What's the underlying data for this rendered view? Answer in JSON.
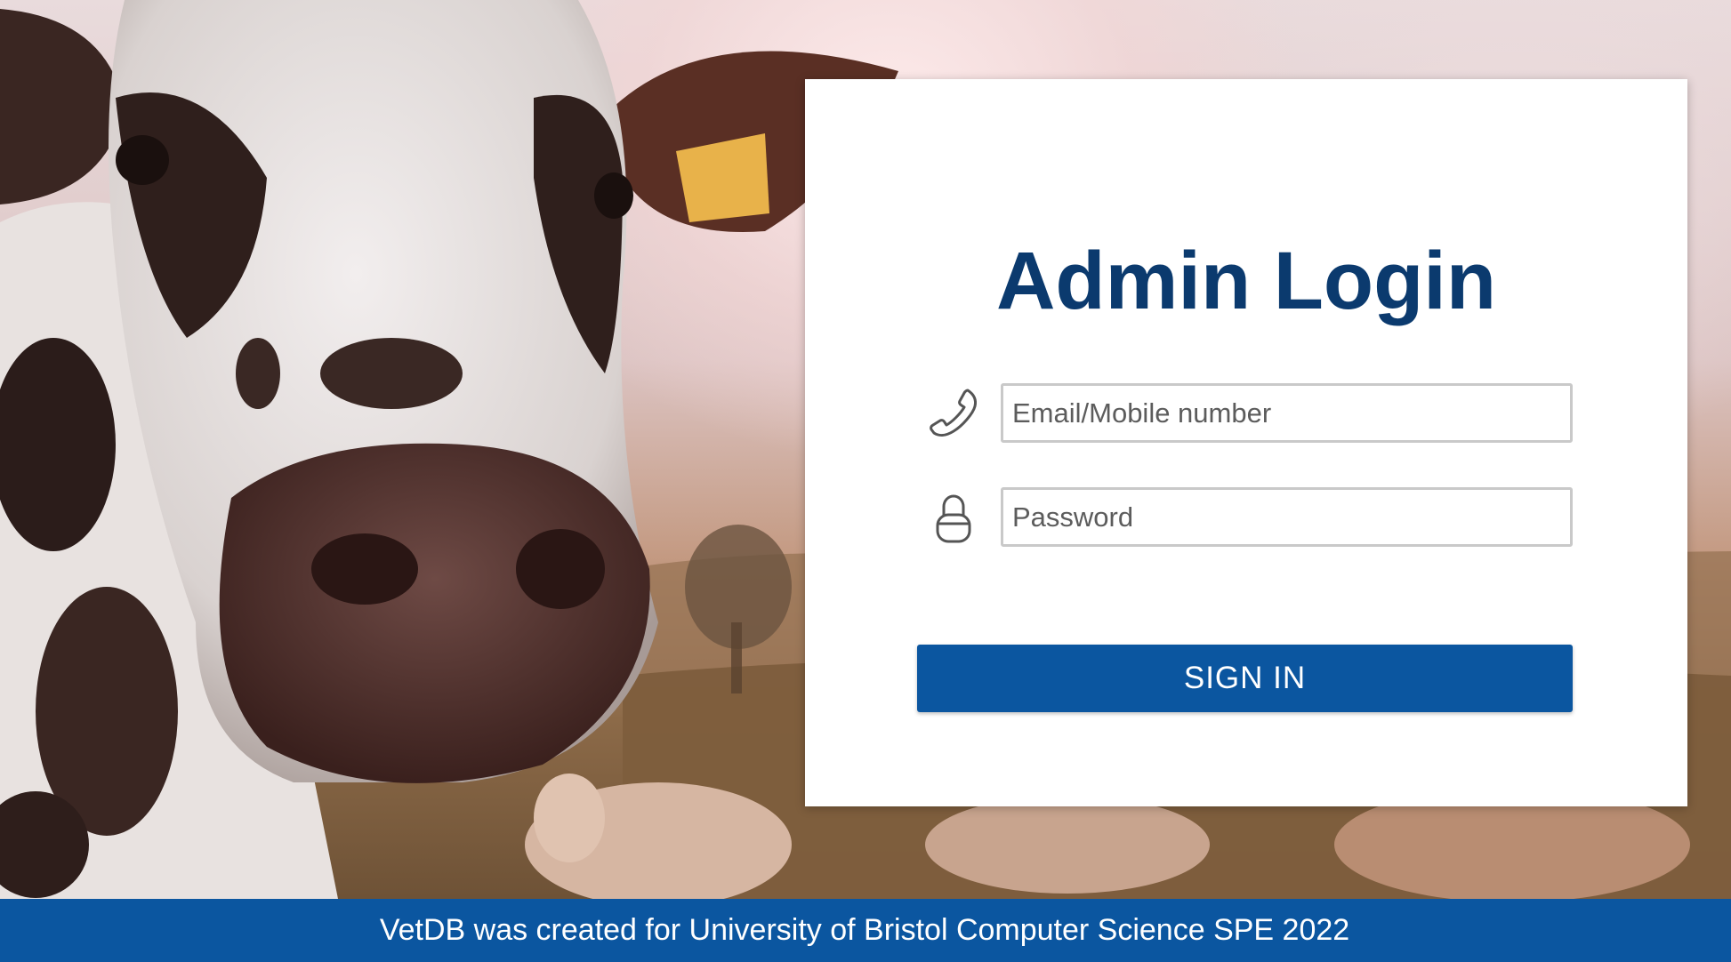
{
  "login_card": {
    "title": "Admin Login",
    "email_placeholder": "Email/Mobile number",
    "password_placeholder": "Password",
    "sign_in_label": "SIGN IN"
  },
  "icons": {
    "email": "phone-icon",
    "password": "lock-icon"
  },
  "footer": {
    "text": "VetDB was created for University of Bristol Computer Science SPE 2022"
  },
  "colors": {
    "title": "#0b3a6e",
    "primary": "#0b56a0"
  }
}
